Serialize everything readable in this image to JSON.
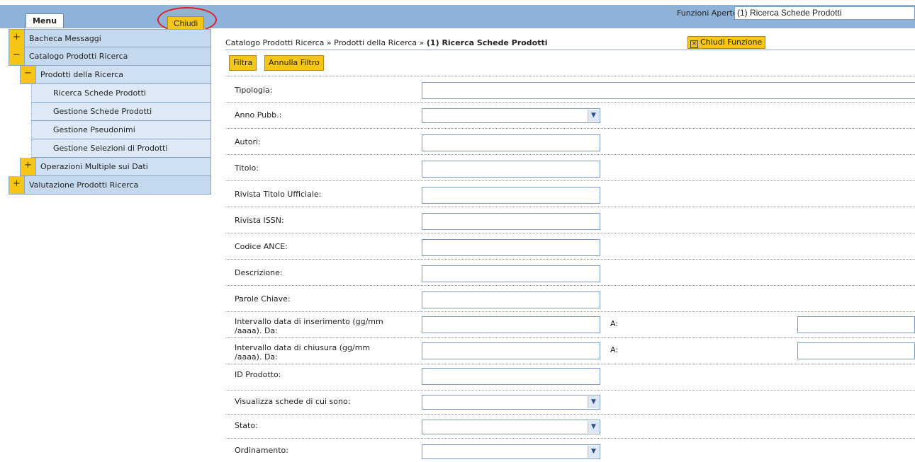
{
  "topbar": {
    "menu_label": "Menu",
    "close_label": "Chiudi",
    "open_functions_label": "Funzioni Aperte:",
    "open_functions_value": "(1) Ricerca Schede Prodotti"
  },
  "sidebar": {
    "items": [
      {
        "label": "Bacheca Messaggi",
        "toggle": "+"
      },
      {
        "label": "Catalogo Prodotti Ricerca",
        "toggle": "−"
      },
      {
        "label": "Prodotti della Ricerca",
        "toggle": "−"
      },
      {
        "label": "Ricerca Schede Prodotti"
      },
      {
        "label": "Gestione Schede Prodotti"
      },
      {
        "label": "Gestione Pseudonimi"
      },
      {
        "label": "Gestione Selezioni di Prodotti"
      },
      {
        "label": "Operazioni Multiple sui Dati",
        "toggle": "+"
      },
      {
        "label": "Valutazione Prodotti Ricerca",
        "toggle": "+"
      }
    ]
  },
  "breadcrumb": {
    "part1": "Catalogo Prodotti Ricerca",
    "sep": " » ",
    "part2": "Prodotti della Ricerca",
    "current": "(1) Ricerca Schede Prodotti"
  },
  "actions": {
    "close_function": "Chiudi Funzione",
    "filter": "Filtra",
    "cancel_filter": "Annulla Filtro"
  },
  "form": {
    "tipologia": "Tipologia:",
    "anno": "Anno Pubb.:",
    "autori": "Autori:",
    "titolo": "Titolo:",
    "rivista_titolo": "Rivista Titolo Ufficiale:",
    "rivista_issn": "Rivista ISSN:",
    "codice_ance": "Codice ANCE:",
    "descrizione": "Descrizione:",
    "parole_chiave": "Parole Chiave:",
    "int_inserimento_1": "Intervallo data di inserimento (gg/mm",
    "int_inserimento_2": "/aaaa). Da:",
    "int_chiusura_1": "Intervallo data di chiusura (gg/mm",
    "int_chiusura_2": "/aaaa). Da:",
    "a_label": "A:",
    "id_prodotto": "ID Prodotto:",
    "visualizza": "Visualizza schede di cui sono:",
    "stato": "Stato:",
    "ordinamento": "Ordinamento:"
  }
}
